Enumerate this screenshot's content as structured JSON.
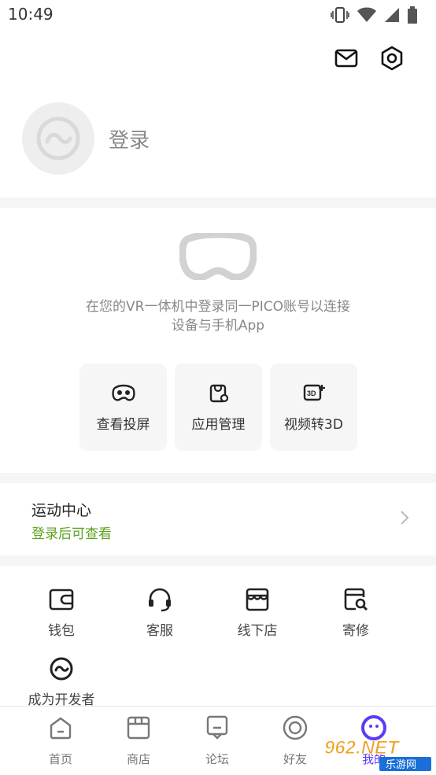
{
  "status_bar": {
    "time": "10:49",
    "icons": [
      "vibrate-icon",
      "wifi-icon",
      "signal-icon",
      "battery-icon"
    ]
  },
  "header": {
    "icons": [
      "mail-icon",
      "settings-icon"
    ]
  },
  "profile": {
    "login_label": "登录",
    "avatar_icon": "avatar-placeholder-icon"
  },
  "vr_connect": {
    "headset_icon": "vr-headset-icon",
    "description_line1": "在您的VR一体机中登录同一PICO账号以连接",
    "description_line2": "设备与手机App",
    "actions": [
      {
        "label": "查看投屏",
        "icon": "screen-cast-icon"
      },
      {
        "label": "应用管理",
        "icon": "app-manage-icon"
      },
      {
        "label": "视频转3D",
        "icon": "video-3d-icon"
      }
    ]
  },
  "sport_center": {
    "title": "运动中心",
    "subtitle": "登录后可查看",
    "subtitle_color": "#5ea21f",
    "chevron_icon": "chevron-right-icon"
  },
  "services": [
    {
      "label": "钱包",
      "icon": "wallet-icon"
    },
    {
      "label": "客服",
      "icon": "headset-service-icon"
    },
    {
      "label": "线下店",
      "icon": "store-icon"
    },
    {
      "label": "寄修",
      "icon": "repair-icon"
    },
    {
      "label": "成为开发者",
      "icon": "developer-icon"
    }
  ],
  "tabbar": [
    {
      "label": "首页",
      "icon": "home-icon"
    },
    {
      "label": "商店",
      "icon": "shop-icon"
    },
    {
      "label": "论坛",
      "icon": "forum-icon"
    },
    {
      "label": "好友",
      "icon": "friends-icon"
    },
    {
      "label": "我的",
      "icon": "profile-icon",
      "active": true
    }
  ],
  "watermark": {
    "brand": "962.NET",
    "sub": "乐游网"
  },
  "colors": {
    "accent_green": "#5ea21f",
    "tab_active": "#5b3cf5"
  }
}
